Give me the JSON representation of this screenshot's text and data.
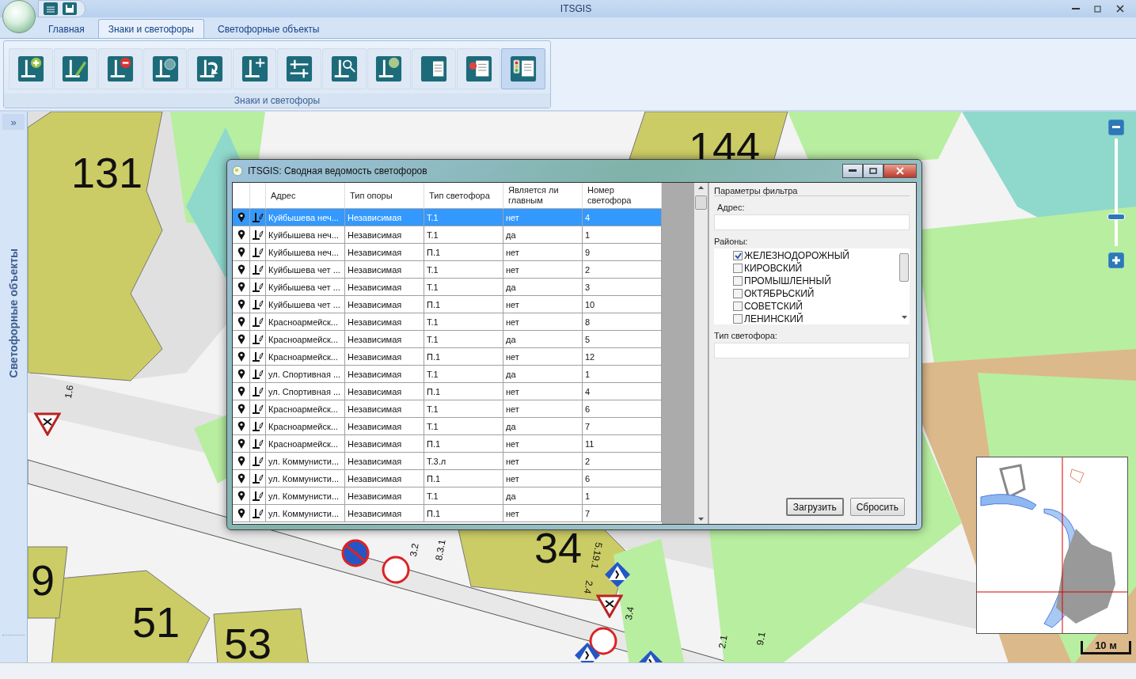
{
  "window": {
    "title": "ITSGIS"
  },
  "ribbon": {
    "tabs": [
      {
        "label": "Главная",
        "selected": false
      },
      {
        "label": "Знаки и светофоры",
        "selected": true
      },
      {
        "label": "Светофорные объекты",
        "selected": false
      }
    ],
    "tools": [
      {
        "selected": false
      },
      {
        "selected": false
      },
      {
        "selected": false
      },
      {
        "selected": false
      },
      {
        "selected": false
      },
      {
        "selected": false
      },
      {
        "selected": false
      },
      {
        "selected": false
      },
      {
        "selected": false
      },
      {
        "selected": false
      },
      {
        "selected": false
      },
      {
        "selected": true
      }
    ],
    "group_label": "Знаки и светофоры"
  },
  "sidebar": {
    "label": "Светофорные объекты",
    "expand_button": "»"
  },
  "map": {
    "labels": [
      "131",
      "144",
      "34",
      "51",
      "9",
      "53",
      "1.6",
      "3.2",
      "8.3.1",
      "5.19.1",
      "2.4",
      "3.4",
      "9.1",
      "2.1"
    ],
    "scale": "10 м",
    "zoom": {
      "level": 0.24
    }
  },
  "dialog": {
    "title": "ITSGIS: Сводная ведомость светофоров",
    "columns": [
      "Адрес",
      "Тип опоры",
      "Тип светофора",
      "Является ли главным",
      "Номер светофора"
    ],
    "rows": [
      {
        "address": "Куйбышева неч...",
        "support": "Независимая",
        "type": "Т.1",
        "main": "нет",
        "number": "4",
        "selected": true
      },
      {
        "address": "Куйбышева неч...",
        "support": "Независимая",
        "type": "Т.1",
        "main": "да",
        "number": "1",
        "selected": false
      },
      {
        "address": "Куйбышева неч...",
        "support": "Независимая",
        "type": "П.1",
        "main": "нет",
        "number": "9",
        "selected": false
      },
      {
        "address": "Куйбышева чет ...",
        "support": "Независимая",
        "type": "Т.1",
        "main": "нет",
        "number": "2",
        "selected": false
      },
      {
        "address": "Куйбышева чет ...",
        "support": "Независимая",
        "type": "Т.1",
        "main": "да",
        "number": "3",
        "selected": false
      },
      {
        "address": "Куйбышева чет ...",
        "support": "Независимая",
        "type": "П.1",
        "main": "нет",
        "number": "10",
        "selected": false
      },
      {
        "address": "Красноармейск...",
        "support": "Независимая",
        "type": "Т.1",
        "main": "нет",
        "number": "8",
        "selected": false
      },
      {
        "address": "Красноармейск...",
        "support": "Независимая",
        "type": "Т.1",
        "main": "да",
        "number": "5",
        "selected": false
      },
      {
        "address": "Красноармейск...",
        "support": "Независимая",
        "type": "П.1",
        "main": "нет",
        "number": "12",
        "selected": false
      },
      {
        "address": "ул. Спортивная ...",
        "support": "Независимая",
        "type": "Т.1",
        "main": "да",
        "number": "1",
        "selected": false
      },
      {
        "address": "ул. Спортивная ...",
        "support": "Независимая",
        "type": "П.1",
        "main": "нет",
        "number": "4",
        "selected": false
      },
      {
        "address": "Красноармейск...",
        "support": "Независимая",
        "type": "Т.1",
        "main": "нет",
        "number": "6",
        "selected": false
      },
      {
        "address": "Красноармейск...",
        "support": "Независимая",
        "type": "Т.1",
        "main": "да",
        "number": "7",
        "selected": false
      },
      {
        "address": "Красноармейск...",
        "support": "Независимая",
        "type": "П.1",
        "main": "нет",
        "number": "11",
        "selected": false
      },
      {
        "address": "ул. Коммунисти...",
        "support": "Независимая",
        "type": "Т.3.л",
        "main": "нет",
        "number": "2",
        "selected": false
      },
      {
        "address": "ул. Коммунисти...",
        "support": "Независимая",
        "type": "П.1",
        "main": "нет",
        "number": "6",
        "selected": false
      },
      {
        "address": "ул. Коммунисти...",
        "support": "Независимая",
        "type": "Т.1",
        "main": "да",
        "number": "1",
        "selected": false
      },
      {
        "address": "ул. Коммунисти...",
        "support": "Независимая",
        "type": "П.1",
        "main": "нет",
        "number": "7",
        "selected": false
      }
    ],
    "filter": {
      "title": "Параметры фильтра",
      "address_label": "Адрес:",
      "districts_label": "Районы:",
      "districts": [
        {
          "name": "ЖЕЛЕЗНОДОРОЖНЫЙ",
          "checked": true
        },
        {
          "name": "КИРОВСКИЙ",
          "checked": false
        },
        {
          "name": "ПРОМЫШЛЕННЫЙ",
          "checked": false
        },
        {
          "name": "ОКТЯБРЬСКИЙ",
          "checked": false
        },
        {
          "name": "СОВЕТСКИЙ",
          "checked": false
        },
        {
          "name": "ЛЕНИНСКИЙ",
          "checked": false
        }
      ],
      "type_label": "Тип светофора:",
      "buttons": [
        "Загрузить",
        "Сбросить"
      ]
    }
  }
}
